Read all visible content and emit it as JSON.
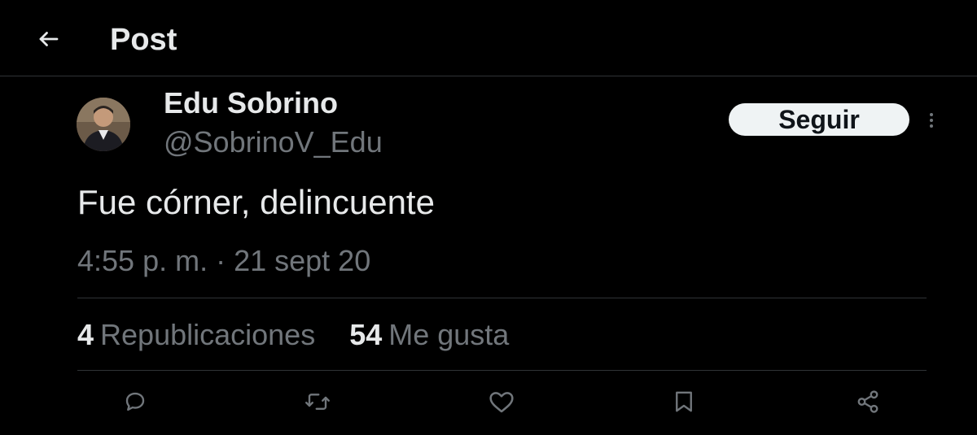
{
  "header": {
    "title": "Post"
  },
  "author": {
    "name": "Edu Sobrino",
    "handle": "@SobrinoV_Edu"
  },
  "follow_button": {
    "label": "Seguir"
  },
  "tweet": {
    "text": "Fue córner, delincuente",
    "timestamp": "4:55 p. m. · 21 sept 20"
  },
  "stats": {
    "reposts_count": "4",
    "reposts_label": "Republicaciones",
    "likes_count": "54",
    "likes_label": "Me gusta"
  },
  "icons": {
    "back": "arrow-left-icon",
    "more": "more-vertical-icon",
    "reply": "reply-icon",
    "repost": "repost-icon",
    "like": "heart-icon",
    "bookmark": "bookmark-icon",
    "share": "share-icon"
  },
  "colors": {
    "background": "#000000",
    "primary_text": "#e7e9ea",
    "secondary_text": "#71767b",
    "divider": "#2f3336",
    "follow_button_bg": "#eff3f4",
    "follow_button_text": "#0f1419"
  }
}
